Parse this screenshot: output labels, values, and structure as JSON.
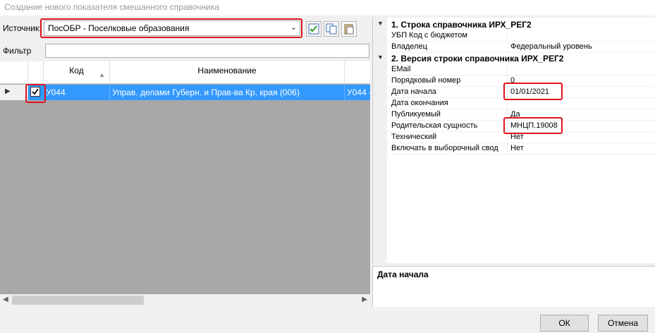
{
  "window": {
    "title": "Создание нового показателя смешанного справочника"
  },
  "source": {
    "label": "Источник:",
    "value": "ПосОБР - Поселковые образования"
  },
  "toolbar": {
    "icons": [
      "check-list-icon",
      "copy-icon",
      "paste-icon"
    ]
  },
  "filter": {
    "label": "Фильтр",
    "value": ""
  },
  "grid": {
    "columns": [
      "Код",
      "Наименование"
    ],
    "rows": [
      {
        "checked": true,
        "code": "У044",
        "name": "Управ. делами Губерн. и Прав-ва Кр. края (006)",
        "extra": "У044 -"
      }
    ]
  },
  "properties": {
    "sections": [
      {
        "title": "1. Строка справочника ИРХ_РЕГ2",
        "items": [
          {
            "name": "УБП Код с бюджетом",
            "value": ""
          },
          {
            "name": "Владелец",
            "value": "Федеральный уровень"
          }
        ]
      },
      {
        "title": "2. Версия строки справочника ИРХ_РЕГ2",
        "items": [
          {
            "name": "EMail",
            "value": ""
          },
          {
            "name": "Порядковый номер",
            "value": "0"
          },
          {
            "name": "Дата начала",
            "value": "01/01/2021"
          },
          {
            "name": "Дата окончания",
            "value": ""
          },
          {
            "name": "Публикуемый",
            "value": "Да"
          },
          {
            "name": "Родительская сущность",
            "value": "МНЦП.19008"
          },
          {
            "name": "Технический",
            "value": "Нет"
          },
          {
            "name": "Включать в выборочный свод",
            "value": "Нет"
          }
        ]
      }
    ]
  },
  "description": {
    "title": "Дата начала"
  },
  "buttons": {
    "ok": "ОК",
    "cancel": "Отмена"
  },
  "colors": {
    "highlight": "#e0141e",
    "selection": "#3399ff"
  }
}
